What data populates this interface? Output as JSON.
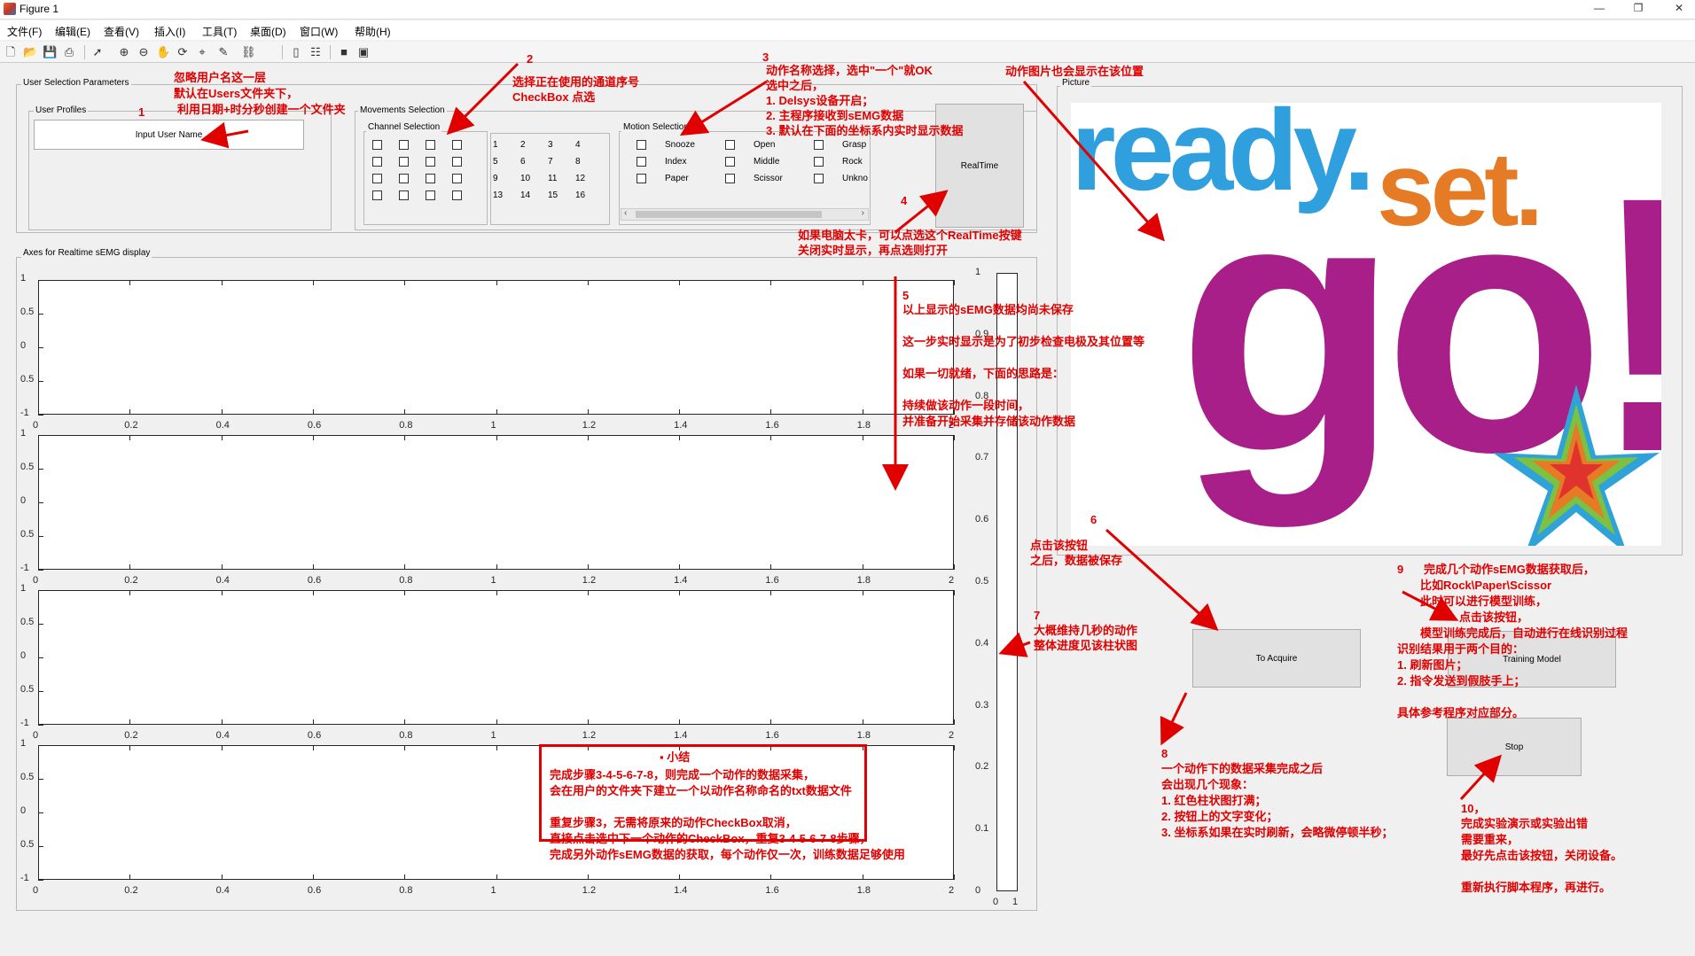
{
  "window": {
    "title": "Figure 1",
    "minimize": "—",
    "restore": "❐",
    "close": "✕"
  },
  "menu": [
    "文件(F)",
    "编辑(E)",
    "查看(V)",
    "插入(I)",
    "工具(T)",
    "桌面(D)",
    "窗口(W)",
    "帮助(H)"
  ],
  "toolbar_icons": [
    "new-file-icon",
    "open-file-icon",
    "save-icon",
    "print-icon",
    "pointer-icon",
    "zoom-in-icon",
    "zoom-out-icon",
    "pan-icon",
    "rotate-icon",
    "data-cursor-icon",
    "brush-icon",
    "link-plot-icon",
    "colorbar-icon",
    "legend-icon",
    "hide-plot-tools-icon",
    "show-plot-tools-icon"
  ],
  "panels": {
    "user_selection": "User Selection Parameters",
    "user_profiles": "User Profiles",
    "movements_selection": "Movements Selection",
    "channel_selection": "Channel Selection",
    "motion_selection": "Motion Selection",
    "picture": "Picture",
    "axes": "Axes for Realtime sEMG display"
  },
  "user_input": {
    "value": "Input User Name"
  },
  "channels": [
    "1",
    "2",
    "3",
    "4",
    "5",
    "6",
    "7",
    "8",
    "9",
    "10",
    "11",
    "12",
    "13",
    "14",
    "15",
    "16"
  ],
  "motions": [
    [
      "Snooze",
      "Open",
      "Grasp"
    ],
    [
      "Index",
      "Middle",
      "Rock"
    ],
    [
      "Paper",
      "Scissor",
      "Unkno"
    ]
  ],
  "buttons": {
    "realtime": "RealTime",
    "acquire": "To Acquire",
    "training": "Training Model",
    "stop": "Stop"
  },
  "picture_words": {
    "ready": "ready.",
    "set": "set.",
    "go": "go!"
  },
  "axes_ticks": {
    "y": [
      "1",
      "0.5",
      "0",
      "0.5",
      "-1"
    ],
    "x": [
      "0",
      "0.2",
      "0.4",
      "0.6",
      "0.8",
      "1",
      "1.2",
      "1.4",
      "1.6",
      "1.8",
      "2"
    ]
  },
  "bar_axis": {
    "y": [
      "1",
      "0.9",
      "0.8",
      "0.7",
      "0.6",
      "0.5",
      "0.4",
      "0.3",
      "0.2",
      "0.1",
      "0"
    ],
    "x": [
      "0",
      "1"
    ],
    "value": 0
  },
  "annotations": {
    "a1": {
      "num": "1",
      "lines": [
        "忽略用户名这一层",
        "默认在Users文件夹下，",
        "利用日期+时分秒创建一个文件夹"
      ]
    },
    "a2": {
      "num": "2",
      "lines": [
        "选择正在使用的通道序号",
        "CheckBox 点选"
      ]
    },
    "a3": {
      "num": "3",
      "lines": [
        "动作名称选择，选中\"一个\"就OK",
        "选中之后，",
        "1. Delsys设备开启；",
        "2. 主程序接收到sEMG数据",
        "3. 默认在下面的坐标系内实时显示数据"
      ]
    },
    "pic": {
      "lines": [
        "动作图片也会显示在该位置"
      ]
    },
    "a4": {
      "num": "4",
      "lines": [
        "如果电脑太卡，可以点选这个RealTime按键",
        "关闭实时显示，再点选则打开"
      ]
    },
    "a5": {
      "num": "5",
      "lines": [
        "以上显示的sEMG数据均尚未保存",
        "",
        "这一步实时显示是为了初步检查电极及其位置等",
        "",
        "如果一切就绪，下面的思路是：",
        "",
        "持续做该动作一段时间，",
        "并准备开始采集并存储该动作数据"
      ]
    },
    "a6": {
      "num": "6",
      "lines": [
        "点击该按钮",
        "之后，数据被保存"
      ]
    },
    "a7": {
      "num": "7",
      "lines": [
        "大概维持几秒的动作",
        "整体进度见该柱状图"
      ]
    },
    "a8": {
      "num": "8",
      "lines": [
        "一个动作下的数据采集完成之后",
        "会出现几个现象：",
        "1. 红色柱状图打满；",
        "2. 按钮上的文字变化；",
        "3. 坐标系如果在实时刷新，会略微停顿半秒；"
      ]
    },
    "a9": {
      "num": "9",
      "lines": [
        "完成几个动作sEMG数据获取后，",
        "比如Rock\\Paper\\Scissor",
        "此时可以进行模型训练，",
        "点击该按钮，",
        "模型训练完成后，自动进行在线识别过程",
        "识别结果用于两个目的：",
        "1. 刷新图片；",
        "2. 指令发送到假肢手上；",
        "",
        "具体参考程序对应部分。"
      ]
    },
    "a10": {
      "num": "10，",
      "lines": [
        "完成实验演示或实验出错",
        "需要重来，",
        "最好先点击该按钮，关闭设备。",
        "",
        "重新执行脚本程序，再进行。"
      ]
    },
    "summary": {
      "title": "▪  小结",
      "lines": [
        "完成步骤3-4-5-6-7-8，则完成一个动作的数据采集，",
        "会在用户的文件夹下建立一个以动作名称命名的txt数据文件",
        "",
        "重复步骤3，无需将原来的动作CheckBox取消，",
        "直接点击选中下一个动作的CheckBox，重复3-4-5-6-7-8步骤，",
        "完成另外动作sEMG数据的获取，每个动作仅一次，训练数据足够使用"
      ]
    }
  },
  "colors": {
    "annotation": "#e00000",
    "ready": "#2f9fde",
    "set": "#e57b25",
    "go": "#a81f8a"
  }
}
